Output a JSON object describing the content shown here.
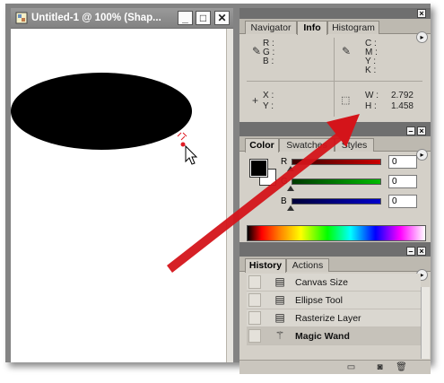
{
  "document": {
    "title": "Untitled-1 @ 100% (Shap...",
    "controls": {
      "minimize": "_",
      "maximize": "□",
      "close": "✕"
    }
  },
  "info_panel": {
    "tabs": [
      {
        "label": "Navigator",
        "active": false
      },
      {
        "label": "Info",
        "active": true
      },
      {
        "label": "Histogram",
        "active": false
      }
    ],
    "rgb_labels": [
      "R :",
      "G :",
      "B :"
    ],
    "cmyk_labels": [
      "C :",
      "M :",
      "Y :",
      "K :"
    ],
    "xy_labels": [
      "X :",
      "Y :"
    ],
    "wh_labels": [
      "W :",
      "H :"
    ],
    "w_value": "2.792",
    "h_value": "1.458",
    "icons": [
      "eyedropper-icon",
      "eyedropper-icon",
      "crosshair-icon",
      "selection-rect-icon"
    ]
  },
  "color_panel": {
    "tabs": [
      {
        "label": "Color",
        "active": true
      },
      {
        "label": "Swatches",
        "active": false
      },
      {
        "label": "Styles",
        "active": false
      }
    ],
    "sliders": [
      {
        "channel": "R",
        "value": "0",
        "color": "#cc0000"
      },
      {
        "channel": "G",
        "value": "0",
        "color": "#00aa00"
      },
      {
        "channel": "B",
        "value": "0",
        "color": "#0000cc"
      }
    ],
    "foreground": "#000000",
    "background": "#ffffff"
  },
  "history_panel": {
    "tabs": [
      {
        "label": "History",
        "active": true
      },
      {
        "label": "Actions",
        "active": false
      }
    ],
    "items": [
      {
        "label": "Canvas Size",
        "selected": false
      },
      {
        "label": "Ellipse Tool",
        "selected": false
      },
      {
        "label": "Rasterize Layer",
        "selected": false
      },
      {
        "label": "Magic Wand",
        "selected": true
      }
    ]
  },
  "annotation": {
    "arrow_color": "#d4141a"
  }
}
